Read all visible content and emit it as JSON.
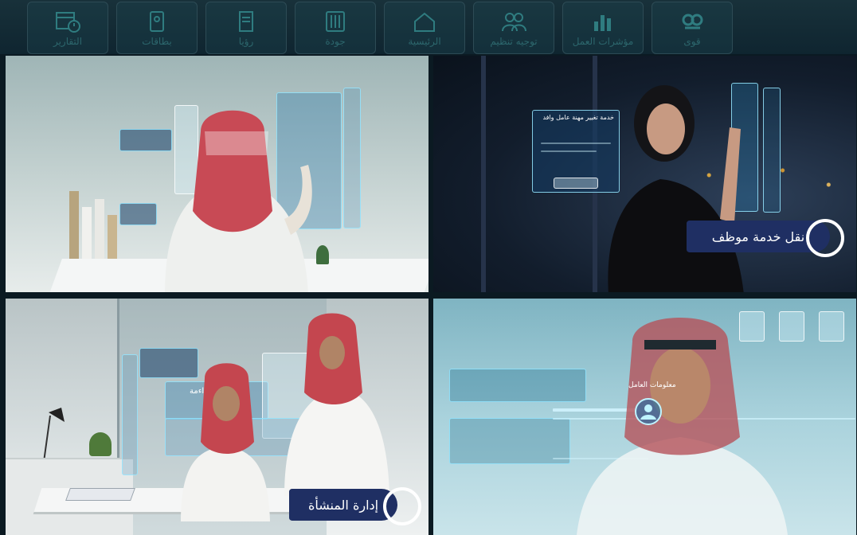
{
  "toolbar": {
    "tiles": [
      {
        "label": "التقارير",
        "icon": "calendar-chart-icon"
      },
      {
        "label": "بطاقات",
        "icon": "card-icon"
      },
      {
        "label": "رؤيا",
        "icon": "document-icon"
      },
      {
        "label": "جودة",
        "icon": "sliders-icon"
      },
      {
        "label": "الرئيسية",
        "icon": "home-icon"
      },
      {
        "label": "توجيه تنظيم",
        "icon": "people-icon"
      },
      {
        "label": "مؤشرات العمل",
        "icon": "bar-chart-icon"
      },
      {
        "label": "قوى",
        "icon": "quwa-logo-icon"
      }
    ]
  },
  "panels": {
    "p2": {
      "caption": "نقل خدمة موظف",
      "holo_title": "خدمة تغيير مهنة عامل وافد"
    },
    "p3": {
      "caption": "إدارة المنشأة",
      "holo_title": "شهادة مواءمة"
    },
    "p4": {
      "holo_title": "معلومات العامل"
    }
  },
  "colors": {
    "ribbon": "#1f2f63",
    "holo": "#8fe6ff"
  }
}
